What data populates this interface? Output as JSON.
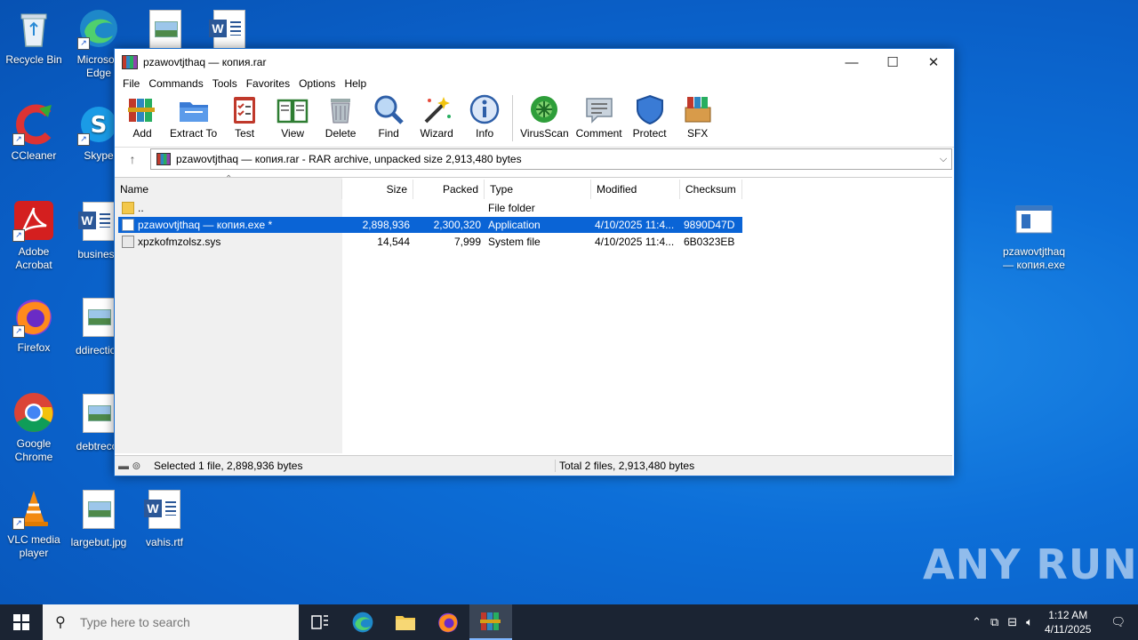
{
  "desktop": {
    "icons": [
      {
        "label": "Recycle Bin"
      },
      {
        "label": "Microsoft Edge"
      },
      {
        "label": "CCleaner"
      },
      {
        "label": "Skype"
      },
      {
        "label": "Adobe Acrobat"
      },
      {
        "label": "business"
      },
      {
        "label": "Firefox"
      },
      {
        "label": "ddirection"
      },
      {
        "label": "Google Chrome"
      },
      {
        "label": "debtrecor"
      },
      {
        "label": "VLC media player"
      },
      {
        "label": "largebut.jpg"
      },
      {
        "label": "vahis.rtf"
      },
      {
        "label": "pzawovtjthaq — копия.exe"
      }
    ]
  },
  "window": {
    "title": "pzawovtjthaq — копия.rar",
    "menu": [
      "File",
      "Commands",
      "Tools",
      "Favorites",
      "Options",
      "Help"
    ],
    "toolbar": [
      "Add",
      "Extract To",
      "Test",
      "View",
      "Delete",
      "Find",
      "Wizard",
      "Info",
      "VirusScan",
      "Comment",
      "Protect",
      "SFX"
    ],
    "address": "pzawovtjthaq — копия.rar - RAR archive, unpacked size 2,913,480 bytes",
    "columns": [
      "Name",
      "Size",
      "Packed",
      "Type",
      "Modified",
      "Checksum"
    ],
    "rows": [
      {
        "name": "..",
        "size": "",
        "packed": "",
        "type": "File folder",
        "modified": "",
        "checksum": ""
      },
      {
        "name": "pzawovtjthaq — копия.exe *",
        "size": "2,898,936",
        "packed": "2,300,320",
        "type": "Application",
        "modified": "4/10/2025 11:4...",
        "checksum": "9890D47D"
      },
      {
        "name": "xpzkofmzolsz.sys",
        "size": "14,544",
        "packed": "7,999",
        "type": "System file",
        "modified": "4/10/2025 11:4...",
        "checksum": "6B0323EB"
      }
    ],
    "status_left": "Selected 1 file, 2,898,936 bytes",
    "status_right": "Total 2 files, 2,913,480 bytes"
  },
  "taskbar": {
    "search_placeholder": "Type here to search",
    "time": "1:12 AM",
    "date": "4/11/2025"
  },
  "watermark": "ANY RUN"
}
